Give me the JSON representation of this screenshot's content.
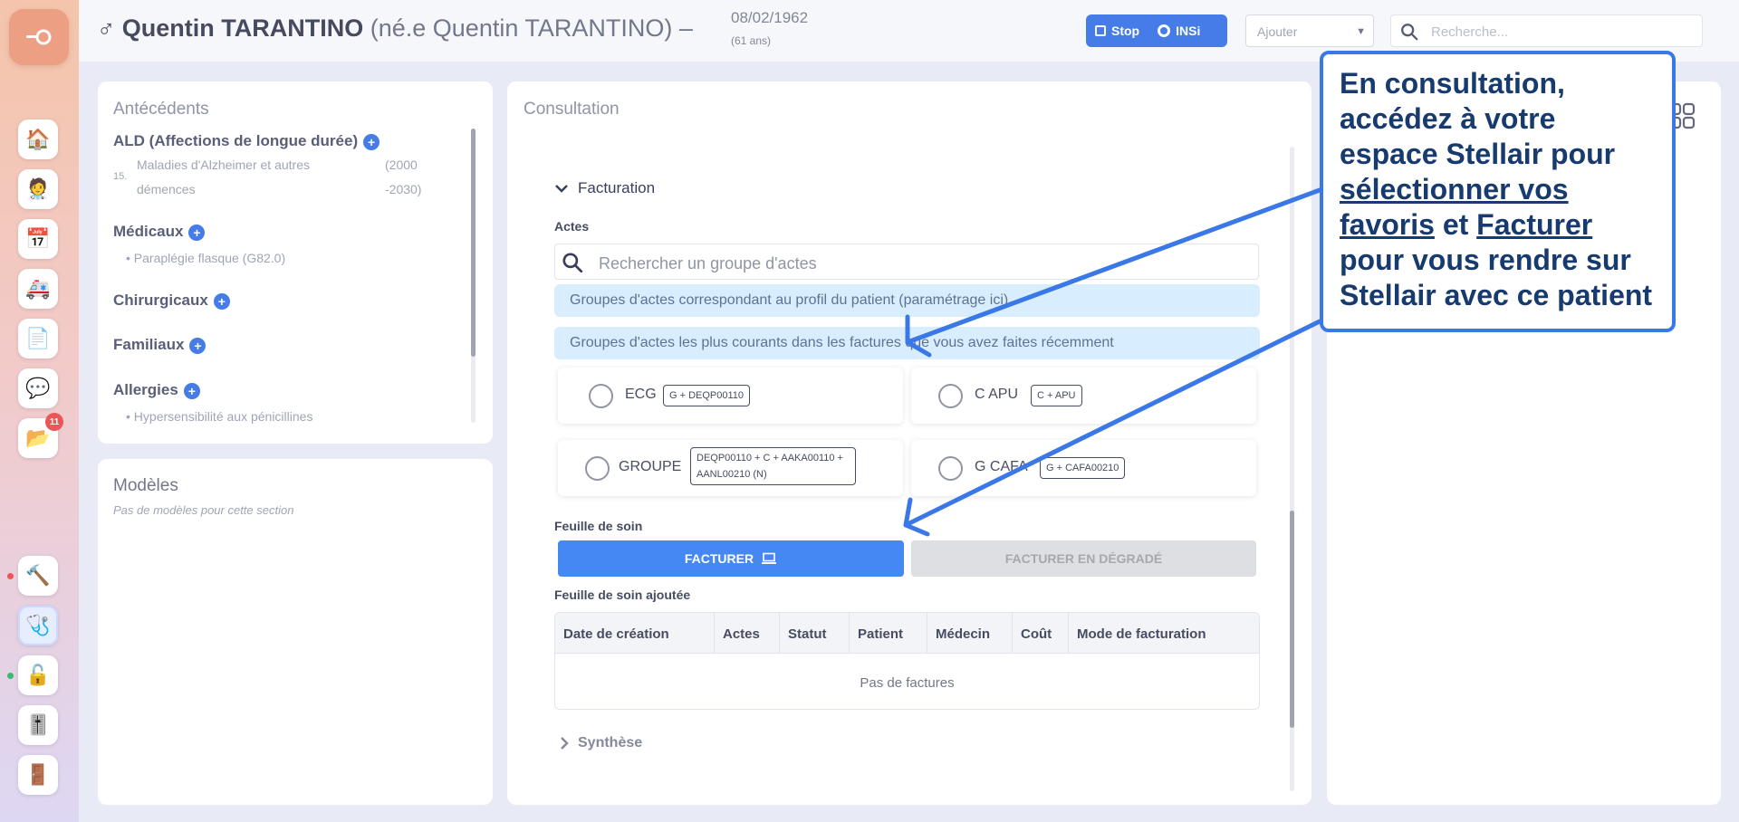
{
  "header": {
    "gender_symbol": "♂",
    "patient_name": "Quentin TARANTINO",
    "birth_name": "(né.e Quentin TARANTINO)",
    "separator": "–",
    "dob": "08/02/1962",
    "age": "(61 ans)",
    "stop_label": "Stop",
    "insi_label": "INSi",
    "ajouter_label": "Ajouter",
    "search_placeholder": "Recherche..."
  },
  "sidebar": {
    "badge_count": "11",
    "items": [
      "home-icon",
      "patient-icon",
      "calendar-icon",
      "transport-icon",
      "documents-icon",
      "messages-icon",
      "folder-icon",
      "tools-icon",
      "stethoscope-icon",
      "lock-icon",
      "settings-icon",
      "logout-icon"
    ],
    "status_dot_colors": [
      "#e84d4d",
      "#2fb36a"
    ]
  },
  "antecedents": {
    "title": "Antécédents",
    "ald_title": "ALD (Affections de longue durée)",
    "ald_num": "15.",
    "ald_item_line1": "Maladies d'Alzheimer et autres",
    "ald_item_line2": "démences",
    "ald_period_line1": "(2000",
    "ald_period_line2": "-2030)",
    "medicaux_title": "Médicaux",
    "medicaux_item": "• Paraplégie flasque (G82.0)",
    "chirurgicaux_title": "Chirurgicaux",
    "familiaux_title": "Familiaux",
    "allergies_title": "Allergies",
    "allergies_item": "• Hypersensibilité aux pénicillines"
  },
  "modeles": {
    "title": "Modèles",
    "empty": "Pas de modèles pour cette section"
  },
  "consultation": {
    "title": "Consultation",
    "facturation_label": "Facturation",
    "actes_label": "Actes",
    "search_placeholder": "Rechercher un groupe d'actes",
    "info_profile": "Groupes d'actes correspondant au profil du patient (paramétrage ici)",
    "info_recent": "Groupes d'actes les plus courants dans les factures que vous avez faites récemment",
    "actes": [
      {
        "name": "ECG",
        "code": "G + DEQP00110"
      },
      {
        "name": "C APU",
        "code": "C + APU"
      },
      {
        "name": "GROUPE",
        "code_line1": "DEQP00110 + C + AAKA00110 +",
        "code_line2": "AANL00210 (N)"
      },
      {
        "name": "G CAFA",
        "code": "G + CAFA00210"
      }
    ],
    "feuille_label": "Feuille de soin",
    "facturer_label": "FACTURER",
    "degrade_label": "FACTURER EN DÉGRADÉ",
    "feuille_ajoutee_label": "Feuille de soin ajoutée",
    "table_headers": [
      "Date de création",
      "Actes",
      "Statut",
      "Patient",
      "Médecin",
      "Coût",
      "Mode de facturation"
    ],
    "table_empty": "Pas de factures",
    "synthese_label": "Synthèse"
  },
  "callout": {
    "line1": "En consultation,",
    "line2": "accédez à votre",
    "line3": "espace Stellair pour",
    "line4_u": "sélectionner vos",
    "line5_u1": "favoris",
    "line5_mid": " et ",
    "line5_u2": "Facturer",
    "line6": "pour vous rendre sur",
    "line7": "Stellair avec ce patient"
  },
  "colors": {
    "accent": "#3b81f3",
    "callout_border": "#3a78e8",
    "callout_text": "#173a6f",
    "info_bar": "#d6ecfd"
  }
}
